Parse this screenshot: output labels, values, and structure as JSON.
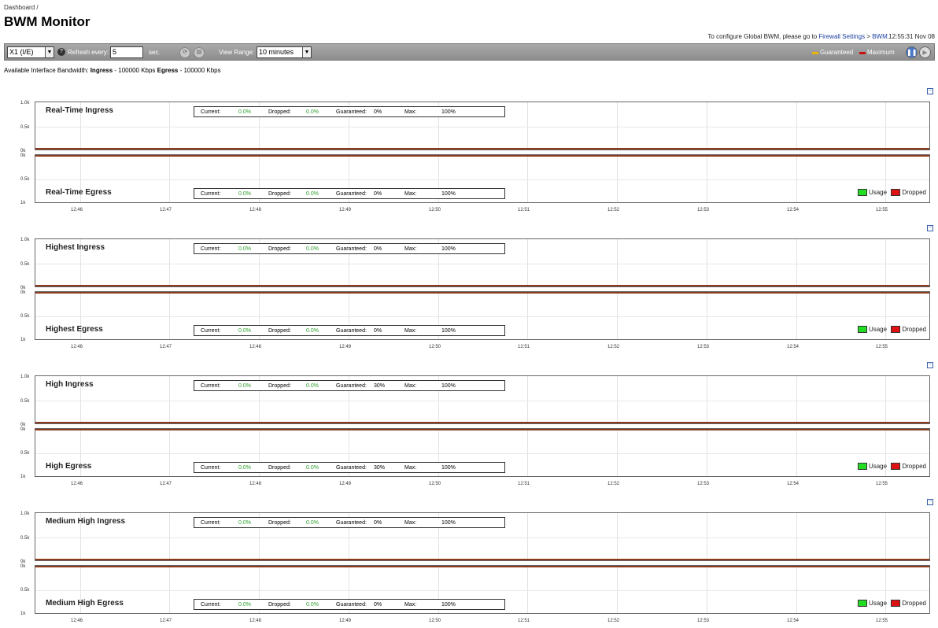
{
  "breadcrumb": "Dashboard /",
  "title": "BWM Monitor",
  "config": {
    "text": "To configure Global BWM, please go to ",
    "link1": "Firewall Settings",
    "sep": " > ",
    "link2": "BWM",
    "end": ".",
    "time": "12:55:31 Nov 08"
  },
  "toolbar": {
    "interface": "X1 (I/E)",
    "help": "?",
    "refresh_label": "Refresh every:",
    "refresh_value": "5",
    "sec_label": "sec.",
    "view_range_label": "View Range:",
    "view_range_value": "10 minutes",
    "legend_guaranteed": "Guaranteed",
    "legend_maximum": "Maximum",
    "colors": {
      "guaranteed": "#e8b500",
      "maximum": "#cc1111"
    }
  },
  "available": {
    "prefix": "Available Interface Bandwidth: ",
    "ingress_label": "Ingress",
    "ingress_value": " - 100000 Kbps ",
    "egress_label": "Egress",
    "egress_value": " - 100000 Kbps"
  },
  "labels": {
    "current": "Current:",
    "dropped": "Dropped:",
    "guaranteed": "Guaranteed:",
    "max": "Max:",
    "usage": "Usage",
    "dropped_legend": "Dropped",
    "y_top": "1.0k",
    "y_mid": "0.5k",
    "y_zero": "0k",
    "y_bottom": "1k"
  },
  "x_ticks": [
    "12:46",
    "12:47",
    "12:48",
    "12:49",
    "12:50",
    "12:51",
    "12:52",
    "12:53",
    "12:54",
    "12:55"
  ],
  "groups": [
    {
      "ingress_title": "Real-Time Ingress",
      "egress_title": "Real-Time Egress",
      "ingress": {
        "current": "0.0%",
        "dropped": "0.0%",
        "guaranteed": "0%",
        "max": "100%"
      },
      "egress": {
        "current": "0.0%",
        "dropped": "0.0%",
        "guaranteed": "0%",
        "max": "100%"
      }
    },
    {
      "ingress_title": "Highest Ingress",
      "egress_title": "Highest Egress",
      "ingress": {
        "current": "0.0%",
        "dropped": "0.0%",
        "guaranteed": "0%",
        "max": "100%"
      },
      "egress": {
        "current": "0.0%",
        "dropped": "0.0%",
        "guaranteed": "0%",
        "max": "100%"
      }
    },
    {
      "ingress_title": "High Ingress",
      "egress_title": "High Egress",
      "ingress": {
        "current": "0.0%",
        "dropped": "0.0%",
        "guaranteed": "30%",
        "max": "100%"
      },
      "egress": {
        "current": "0.0%",
        "dropped": "0.0%",
        "guaranteed": "30%",
        "max": "100%"
      }
    },
    {
      "ingress_title": "Medium High Ingress",
      "egress_title": "Medium High Egress",
      "ingress": {
        "current": "0.0%",
        "dropped": "0.0%",
        "guaranteed": "0%",
        "max": "100%"
      },
      "egress": {
        "current": "0.0%",
        "dropped": "0.0%",
        "guaranteed": "0%",
        "max": "100%"
      }
    }
  ],
  "colors": {
    "usage": "#22dd22",
    "dropped": "#dd1111",
    "baseline": "#8b3a1a"
  }
}
